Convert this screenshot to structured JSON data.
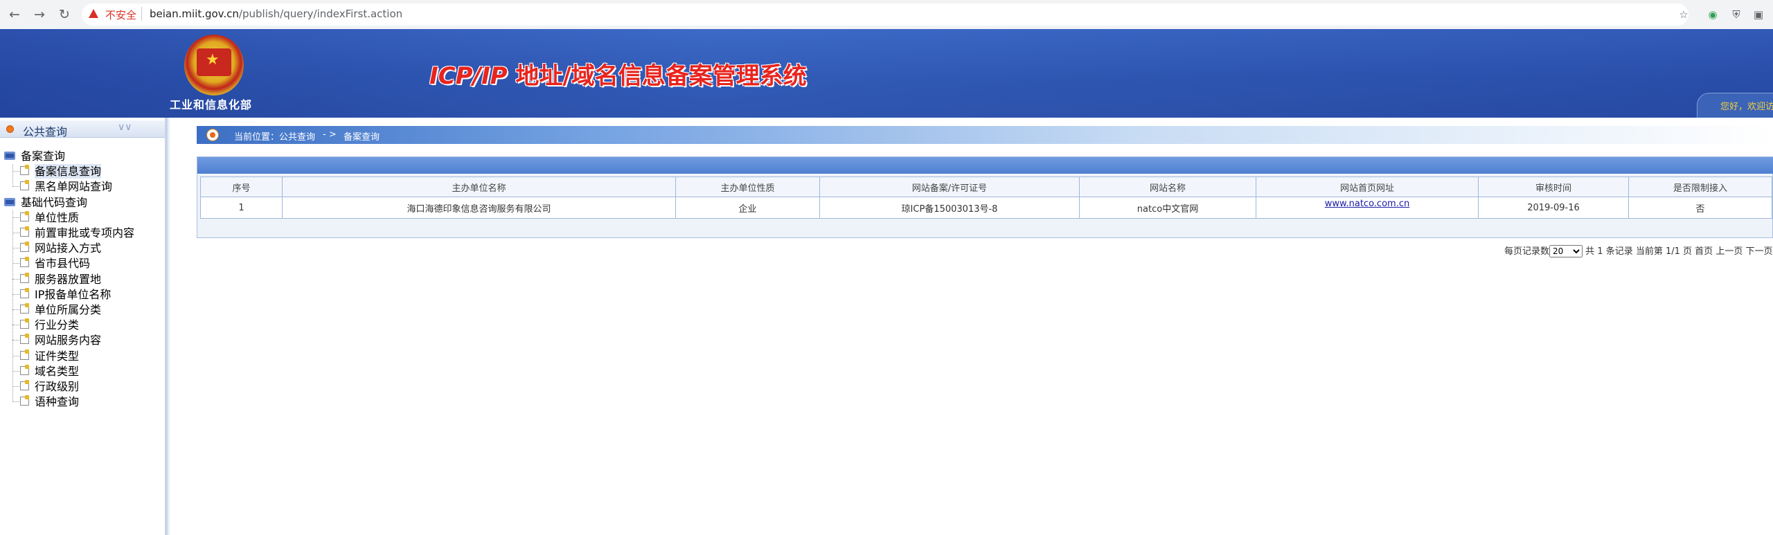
{
  "browser": {
    "security_label": "不安全",
    "url_host": "beian.miit.gov.cn",
    "url_path": "/publish/query/indexFirst.action",
    "icons": [
      "back-icon",
      "forward-icon",
      "reload-icon",
      "star-icon",
      "extension-icon",
      "shield-icon",
      "extension-icon"
    ]
  },
  "header": {
    "ministry": "工业和信息化部",
    "title_prefix": "ICP/IP",
    "title_rest": " 地址/域名信息备案管理系统",
    "greeting": "您好，欢迎访",
    "colors": {
      "header_blue": "#2c55b0",
      "title_red": "#e8241e",
      "greeting_yellow": "#f2d23a"
    }
  },
  "sidebar": {
    "section": "公共查询",
    "groups": [
      {
        "label": "备案查询",
        "items": [
          "备案信息查询",
          "黑名单网站查询"
        ]
      },
      {
        "label": "基础代码查询",
        "items": [
          "单位性质",
          "前置审批或专项内容",
          "网站接入方式",
          "省市县代码",
          "服务器放置地",
          "IP报备单位名称",
          "单位所属分类",
          "行业分类",
          "网站服务内容",
          "证件类型",
          "域名类型",
          "行政级别",
          "语种查询"
        ]
      }
    ],
    "selected": "备案信息查询"
  },
  "breadcrumb": {
    "label": "当前位置：公共查询",
    "arrow": "- >",
    "current": "备案查询"
  },
  "results": {
    "columns": [
      "序号",
      "主办单位名称",
      "主办单位性质",
      "网站备案/许可证号",
      "网站名称",
      "网站首页网址",
      "审核时间",
      "是否限制接入"
    ],
    "rows": [
      [
        "1",
        "海口海德印象信息咨询服务有限公司",
        "企业",
        "琼ICP备15003013号-8",
        "natco中文官网",
        "www.natco.com.cn",
        "2019-09-16",
        "否"
      ]
    ]
  },
  "pager": {
    "per_page_label": "每页记录数",
    "per_page_value": "20",
    "total": "共 1 条记录",
    "page": "当前第 1/1 页",
    "first": "首页",
    "prev": "上一页",
    "next": "下一页"
  }
}
